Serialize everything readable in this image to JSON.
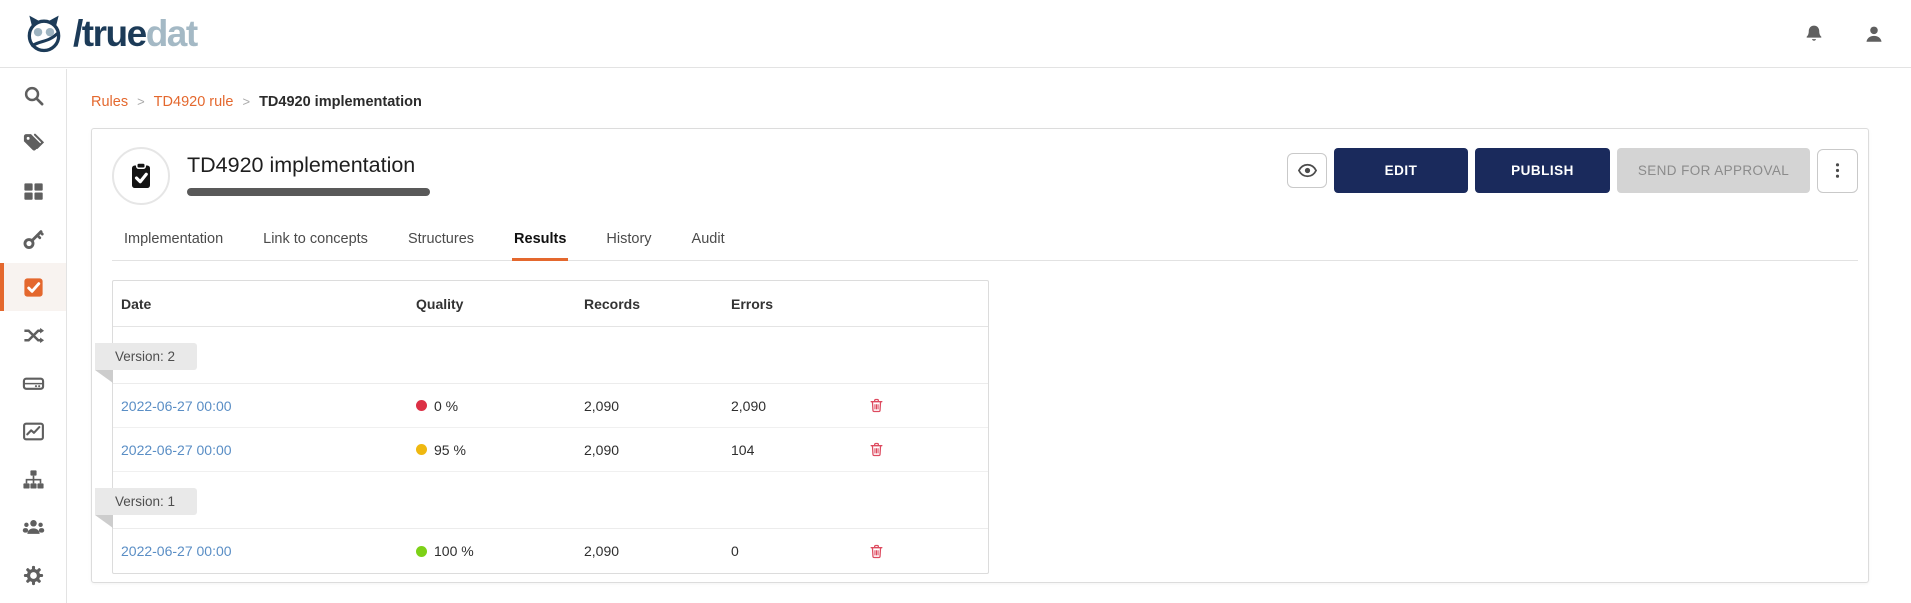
{
  "brand": {
    "logo_dark": "/true",
    "logo_light": "dat"
  },
  "topbar": {
    "icons": [
      "bell-icon",
      "user-icon"
    ]
  },
  "sidebar": {
    "active_index": 4,
    "items": [
      {
        "name": "search",
        "icon": "search-icon"
      },
      {
        "name": "tags",
        "icon": "tags-icon"
      },
      {
        "name": "modules",
        "icon": "grid-icon"
      },
      {
        "name": "permissions",
        "icon": "key-icon"
      },
      {
        "name": "quality",
        "icon": "check-square-icon"
      },
      {
        "name": "lineage",
        "icon": "shuffle-icon"
      },
      {
        "name": "storage",
        "icon": "storage-icon"
      },
      {
        "name": "analytics",
        "icon": "chart-icon"
      },
      {
        "name": "hierarchy",
        "icon": "sitemap-icon"
      },
      {
        "name": "users",
        "icon": "users-icon"
      },
      {
        "name": "settings",
        "icon": "gear-icon"
      }
    ]
  },
  "breadcrumb": {
    "separator": ">",
    "items": [
      {
        "label": "Rules",
        "link": true
      },
      {
        "label": "TD4920 rule",
        "link": true
      },
      {
        "label": "TD4920 implementation",
        "link": false
      }
    ]
  },
  "page": {
    "title": "TD4920 implementation",
    "actions": {
      "edit": "EDIT",
      "publish": "PUBLISH",
      "send_for_approval": "SEND FOR APPROVAL"
    },
    "tabs": [
      {
        "label": "Implementation",
        "active": false
      },
      {
        "label": "Link to concepts",
        "active": false
      },
      {
        "label": "Structures",
        "active": false
      },
      {
        "label": "Results",
        "active": true
      },
      {
        "label": "History",
        "active": false
      },
      {
        "label": "Audit",
        "active": false
      }
    ]
  },
  "results_table": {
    "columns": [
      "Date",
      "Quality",
      "Records",
      "Errors"
    ],
    "groups": [
      {
        "version_label": "Version: 2",
        "rows": [
          {
            "date": "2022-06-27 00:00",
            "quality": "0 %",
            "quality_color": "#dc3045",
            "records": "2,090",
            "errors": "2,090"
          },
          {
            "date": "2022-06-27 00:00",
            "quality": "95 %",
            "quality_color": "#efb810",
            "records": "2,090",
            "errors": "104"
          }
        ]
      },
      {
        "version_label": "Version: 1",
        "rows": [
          {
            "date": "2022-06-27 00:00",
            "quality": "100 %",
            "quality_color": "#7dd117",
            "records": "2,090",
            "errors": "0"
          }
        ]
      }
    ]
  },
  "colors": {
    "accent_orange": "#e4682e",
    "primary_navy": "#1a2a5c",
    "link_blue": "#5a8ec5",
    "danger_red": "#dd4a5f",
    "progress_fill": "#595959"
  }
}
